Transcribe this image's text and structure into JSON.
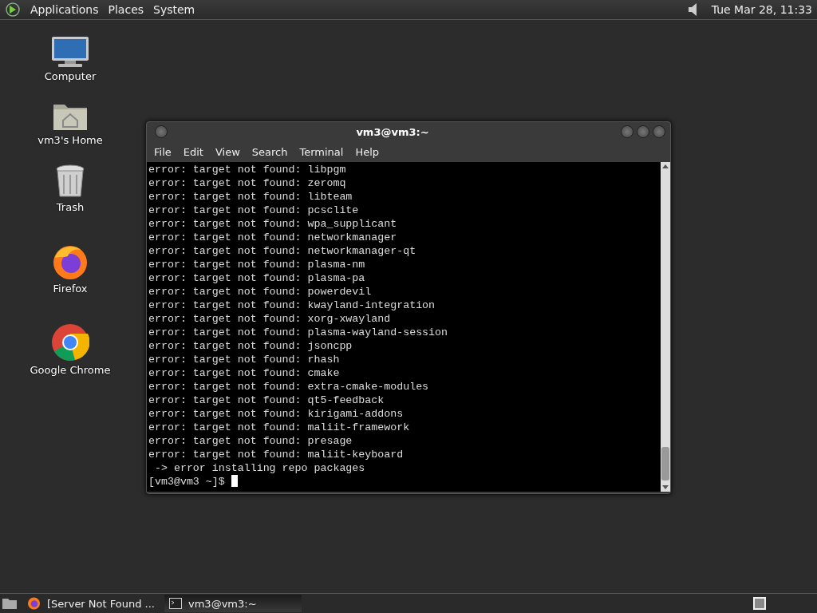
{
  "top_panel": {
    "menus": [
      "Applications",
      "Places",
      "System"
    ],
    "clock": "Tue Mar 28, 11:33"
  },
  "desktop_icons": [
    {
      "kind": "computer",
      "label": "Computer"
    },
    {
      "kind": "home",
      "label": "vm3's Home"
    },
    {
      "kind": "trash",
      "label": "Trash"
    },
    {
      "kind": "firefox",
      "label": "Firefox"
    },
    {
      "kind": "chrome",
      "label": "Google Chrome"
    }
  ],
  "window": {
    "title": "vm3@vm3:~",
    "menu": [
      "File",
      "Edit",
      "View",
      "Search",
      "Terminal",
      "Help"
    ],
    "lines": [
      "error: target not found: libpgm",
      "error: target not found: zeromq",
      "error: target not found: libteam",
      "error: target not found: pcsclite",
      "error: target not found: wpa_supplicant",
      "error: target not found: networkmanager",
      "error: target not found: networkmanager-qt",
      "error: target not found: plasma-nm",
      "error: target not found: plasma-pa",
      "error: target not found: powerdevil",
      "error: target not found: kwayland-integration",
      "error: target not found: xorg-xwayland",
      "error: target not found: plasma-wayland-session",
      "error: target not found: jsoncpp",
      "error: target not found: rhash",
      "error: target not found: cmake",
      "error: target not found: extra-cmake-modules",
      "error: target not found: qt5-feedback",
      "error: target not found: kirigami-addons",
      "error: target not found: maliit-framework",
      "error: target not found: presage",
      "error: target not found: maliit-keyboard",
      " -> error installing repo packages"
    ],
    "prompt": "[vm3@vm3 ~]$"
  },
  "taskbar": {
    "tasks": [
      {
        "kind": "browser",
        "label": "[Server Not Found ...",
        "selected": false
      },
      {
        "kind": "terminal",
        "label": "vm3@vm3:~",
        "selected": true
      }
    ]
  }
}
